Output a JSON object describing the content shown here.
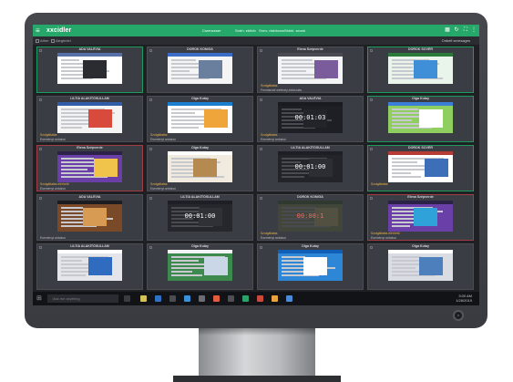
{
  "app": {
    "logo": "xxcidler",
    "header_links": [
      "Csrenceser",
      "Sntrh. ebfieb",
      "Srmv. nlsbbcsnr",
      "Sbbbl. seosb"
    ],
    "subbar_items": [
      "Ather",
      "Alegtmtel"
    ],
    "subbar_button": "Onbefi seresages"
  },
  "tiles": [
    {
      "name": "ADA VALÉVIA",
      "frame": "green",
      "alert": "",
      "note": "",
      "overlay": ""
    },
    {
      "name": "DORÖK KÖNIGÁ",
      "frame": "",
      "alert": "",
      "note": "",
      "overlay": ""
    },
    {
      "name": "Elena Szépverde",
      "frame": "",
      "alert": "Szolgáltatás",
      "note": "Fenntartott webhely-blokkolás",
      "overlay": ""
    },
    {
      "name": "DORÖK SÖVÉR",
      "frame": "green",
      "alert": "",
      "note": "",
      "overlay": ""
    },
    {
      "name": "LILTIA ALAKÍTÓSÜLLAM",
      "frame": "",
      "alert": "Szolgáltatás",
      "note": "Eseményt anbaisó",
      "overlay": ""
    },
    {
      "name": "Olga Kutay",
      "frame": "",
      "alert": "Szolgáltatás",
      "note": "Eseményt anbaisó",
      "overlay": ""
    },
    {
      "name": "ADA VALÉVIA",
      "frame": "",
      "alert": "Szolgáltatás",
      "note": "Eseményt anbaisó",
      "overlay": "00:01:03"
    },
    {
      "name": "Olga Kutay",
      "frame": "green",
      "alert": "",
      "note": "",
      "overlay": ""
    },
    {
      "name": "Elena Szépverde",
      "frame": "red",
      "alert": "Szolgáltatás elérhető",
      "note": "Eseményt anbaisó",
      "overlay": ""
    },
    {
      "name": "Olga Kutay",
      "frame": "",
      "alert": "Szolgáltatás",
      "note": "Eseményt anbaisó",
      "overlay": ""
    },
    {
      "name": "LILTIA ALAKÍTÓSÜLLAM",
      "frame": "",
      "alert": "",
      "note": "",
      "overlay": "00:01:00"
    },
    {
      "name": "DORÖK SÖVÉR",
      "frame": "green",
      "alert": "Szolgáltatás",
      "note": "",
      "overlay": ""
    },
    {
      "name": "ADA VALÉVIA",
      "frame": "",
      "alert": "",
      "note": "Eseményt anbaisó",
      "overlay": ""
    },
    {
      "name": "LILTIA ALAKÍTÓSÜLLAM",
      "frame": "",
      "alert": "",
      "note": "",
      "overlay": "00:01:00"
    },
    {
      "name": "DORÖK KÖNIGÁ",
      "frame": "",
      "alert": "Szolgáltatás",
      "note": "Eseményt anbaisó",
      "overlay": "00:00:1",
      "overlay_red": true
    },
    {
      "name": "Elena Szépverde",
      "frame": "red",
      "alert": "Szolgáltatás elérhető",
      "note": "Eseményt anbaisó",
      "overlay": ""
    },
    {
      "name": "LILTIA ALAKÍTÓSÜLLAM",
      "frame": "",
      "alert": "",
      "note": "",
      "overlay": ""
    },
    {
      "name": "Olga Kutay",
      "frame": "",
      "alert": "",
      "note": "",
      "overlay": ""
    },
    {
      "name": "Olga Kutay",
      "frame": "",
      "alert": "",
      "note": "",
      "overlay": ""
    },
    {
      "name": "Olga Kutay",
      "frame": "",
      "alert": "",
      "note": "",
      "overlay": ""
    }
  ],
  "taskbar": {
    "search_placeholder": "Ask me anything",
    "time": "3:00 AM",
    "date": "1/28/2019"
  },
  "colors": {
    "accent": "#26a86a",
    "alert": "#e8b04a",
    "danger": "#a33d45",
    "bezel": "#3c3e44"
  }
}
